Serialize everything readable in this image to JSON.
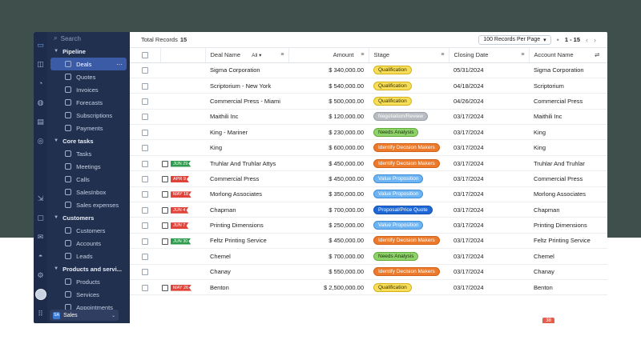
{
  "sidebar": {
    "search_placeholder": "Search",
    "groups": [
      {
        "label": "Pipeline",
        "items": [
          {
            "label": "Deals",
            "active": true
          },
          {
            "label": "Quotes"
          },
          {
            "label": "Invoices"
          },
          {
            "label": "Forecasts"
          },
          {
            "label": "Subscriptions"
          },
          {
            "label": "Payments"
          }
        ]
      },
      {
        "label": "Core tasks",
        "items": [
          {
            "label": "Tasks"
          },
          {
            "label": "Meetings"
          },
          {
            "label": "Calls"
          },
          {
            "label": "SalesInbox"
          },
          {
            "label": "Sales expenses"
          }
        ]
      },
      {
        "label": "Customers",
        "items": [
          {
            "label": "Customers"
          },
          {
            "label": "Accounts"
          },
          {
            "label": "Leads"
          }
        ]
      },
      {
        "label": "Products and servi...",
        "items": [
          {
            "label": "Products"
          },
          {
            "label": "Services"
          },
          {
            "label": "Appointments"
          }
        ]
      }
    ],
    "module_switch": {
      "icon_text": "SA",
      "label": "Sales"
    },
    "more_glyph": "···"
  },
  "toolbar": {
    "total_label": "Total Records",
    "total_value": "15",
    "per_page": "100 Records Per Page",
    "per_page_arrow": "▾",
    "range": "1 - 15",
    "prev": "‹",
    "next": "›",
    "dot": "•"
  },
  "columns": {
    "deal_name": "Deal Name",
    "all": "All",
    "amount": "Amount",
    "stage": "Stage",
    "closing_date": "Closing Date",
    "account_name": "Account Name"
  },
  "colors": {
    "Qualification": {
      "bg": "#f6de5a",
      "border": "#d4b216",
      "fg": "#3a3100"
    },
    "Negotiation/Review": {
      "bg": "#b9bcc2",
      "border": "#9a9ea6",
      "fg": "#ffffff"
    },
    "Needs Analysis": {
      "bg": "#8fd16a",
      "border": "#5fae38",
      "fg": "#17330a"
    },
    "Identify Decision Makers": {
      "bg": "#ec7a2a",
      "border": "#d0621a",
      "fg": "#ffffff"
    },
    "Value Proposition": {
      "bg": "#6fb4f2",
      "border": "#3e8fd8",
      "fg": "#ffffff"
    },
    "Proposal/Price Quote": {
      "bg": "#1d67d6",
      "border": "#1553b3",
      "fg": "#ffffff"
    },
    "tag_green": "#2f9b4c",
    "tag_red": "#e0433a"
  },
  "rows": [
    {
      "checked": false,
      "tag": "",
      "tag_color": "",
      "deal": "Sigma Corporation",
      "amount": "$ 340,000.00",
      "stage": "Qualification",
      "date": "05/31/2024",
      "account": "Sigma Corporation"
    },
    {
      "checked": false,
      "tag": "",
      "tag_color": "",
      "deal": "Scriptorium - New York",
      "amount": "$ 540,000.00",
      "stage": "Qualification",
      "date": "04/18/2024",
      "account": "Scriptorium"
    },
    {
      "checked": false,
      "tag": "",
      "tag_color": "",
      "deal": "Commercial Press - Miami",
      "amount": "$ 500,000.00",
      "stage": "Qualification",
      "date": "04/26/2024",
      "account": "Commercial Press"
    },
    {
      "checked": false,
      "tag": "",
      "tag_color": "",
      "deal": "Maithili Inc",
      "amount": "$ 120,000.00",
      "stage": "Negotiation/Review",
      "date": "03/17/2024",
      "account": "Maithili Inc"
    },
    {
      "checked": false,
      "tag": "",
      "tag_color": "",
      "deal": "King - Mariner",
      "amount": "$ 230,000.00",
      "stage": "Needs Analysis",
      "date": "03/17/2024",
      "account": "King"
    },
    {
      "checked": false,
      "tag": "",
      "tag_color": "",
      "deal": "King",
      "amount": "$ 600,000.00",
      "stage": "Identify Decision Makers",
      "date": "03/17/2024",
      "account": "King"
    },
    {
      "checked": true,
      "tag": "JUN 29",
      "tag_color": "green",
      "deal": "Truhlar And Truhlar Attys",
      "amount": "$ 450,000.00",
      "stage": "Identify Decision Makers",
      "date": "03/17/2024",
      "account": "Truhlar And Truhlar"
    },
    {
      "checked": true,
      "tag": "APR 9",
      "tag_color": "red",
      "deal": "Commercial Press",
      "amount": "$ 450,000.00",
      "stage": "Value Proposition",
      "date": "03/17/2024",
      "account": "Commercial Press"
    },
    {
      "checked": true,
      "tag": "MAY 18",
      "tag_color": "red",
      "deal": "Morlong Associates",
      "amount": "$ 350,000.00",
      "stage": "Value Proposition",
      "date": "03/17/2024",
      "account": "Morlong Associates"
    },
    {
      "checked": true,
      "tag": "JUN 4",
      "tag_color": "red",
      "deal": "Chapman",
      "amount": "$ 700,000.00",
      "stage": "Proposal/Price Quote",
      "date": "03/17/2024",
      "account": "Chapman"
    },
    {
      "checked": true,
      "tag": "JUN 7",
      "tag_color": "red",
      "deal": "Printing Dimensions",
      "amount": "$ 250,000.00",
      "stage": "Value Proposition",
      "date": "03/17/2024",
      "account": "Printing Dimensions"
    },
    {
      "checked": true,
      "tag": "JUN 30",
      "tag_color": "green",
      "deal": "Feltz Printing Service",
      "amount": "$ 450,000.00",
      "stage": "Identify Decision Makers",
      "date": "03/17/2024",
      "account": "Feltz Printing Service"
    },
    {
      "checked": false,
      "tag": "",
      "tag_color": "",
      "deal": "Chemel",
      "amount": "$ 700,000.00",
      "stage": "Needs Analysis",
      "date": "03/17/2024",
      "account": "Chemel"
    },
    {
      "checked": false,
      "tag": "",
      "tag_color": "",
      "deal": "Chanay",
      "amount": "$ 550,000.00",
      "stage": "Identify Decision Makers",
      "date": "03/17/2024",
      "account": "Chanay"
    },
    {
      "checked": true,
      "tag": "MAY 26",
      "tag_color": "red",
      "deal": "Benton",
      "amount": "$ 2,500,000.00",
      "stage": "Qualification",
      "date": "03/17/2024",
      "account": "Benton"
    }
  ],
  "footer_badge": "38"
}
